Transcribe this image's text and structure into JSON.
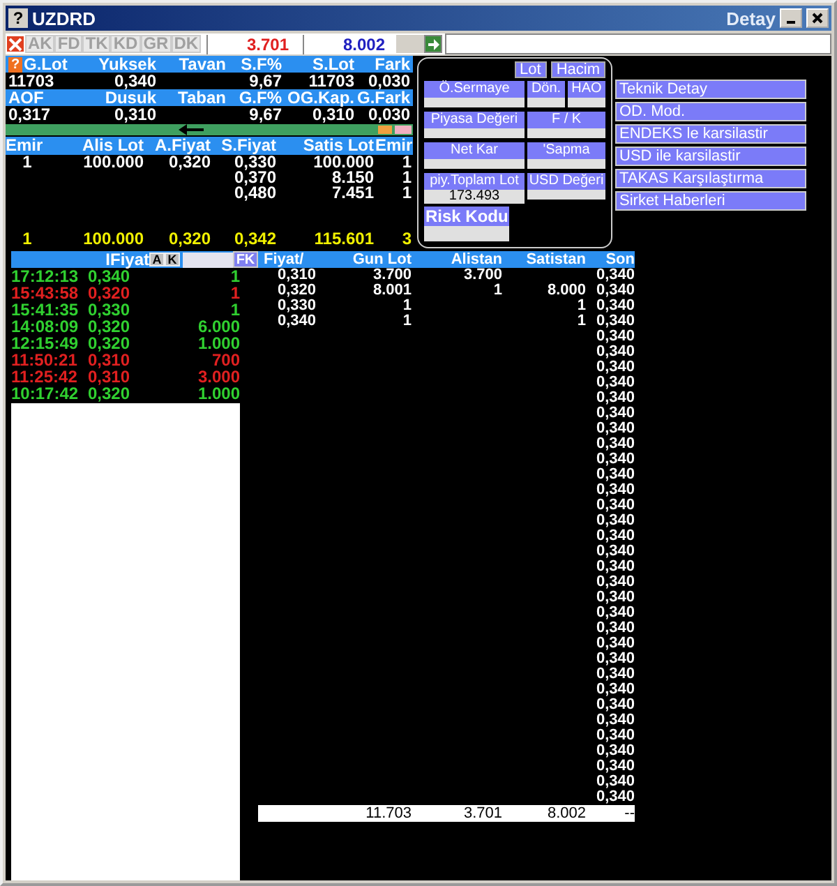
{
  "window": {
    "help": "?",
    "title": "UZDRD",
    "right_title": "Detay"
  },
  "summary_help": "?",
  "toolbar": {
    "tabs": [
      "AK",
      "FD",
      "TK",
      "KD",
      "GR",
      "DK"
    ],
    "buy_total": "3.701",
    "sell_total": "8.002"
  },
  "summary": [
    {
      "kind": "header",
      "cells": [
        "G.Lot",
        "Yuksek",
        "Tavan",
        "S.F%",
        "S.Lot",
        "Fark"
      ]
    },
    {
      "kind": "value",
      "cells": [
        "11703",
        "0,340",
        null,
        "9,67",
        "11703",
        "0,030"
      ]
    },
    {
      "kind": "header",
      "cells": [
        "AOF",
        "Dusuk",
        "Taban",
        "G.F%",
        "OG.Kap.",
        "G.Fark"
      ]
    },
    {
      "kind": "value",
      "cells": [
        "0,317",
        "0,310",
        null,
        "9,67",
        "0,310",
        "0,030"
      ]
    }
  ],
  "order_book": {
    "headers": [
      "Emir",
      "Alis Lot",
      "A.Fiyat",
      "S.Fiyat",
      "Satis Lot",
      "Emir"
    ],
    "rows": [
      [
        "1",
        "100.000",
        "0,320",
        "0,330",
        "100.000",
        "1"
      ],
      [
        null,
        null,
        null,
        "0,370",
        "8.150",
        "1"
      ],
      [
        null,
        null,
        null,
        "0,480",
        "7.451",
        "1"
      ]
    ],
    "totals": [
      "1",
      "100.000",
      "0,320",
      "0,342",
      "115.601",
      "3"
    ]
  },
  "details": {
    "buttons": [
      "Lot",
      "Hacim"
    ],
    "fields": [
      {
        "label": "Ö.Sermaye",
        "kind": "wide"
      },
      {
        "label": "Dön.",
        "kind": "small"
      },
      {
        "label": "HAO",
        "kind": "small"
      },
      {
        "label": "Piyasa Değeri",
        "kind": "wide"
      },
      {
        "label": "F / K",
        "kind": "half"
      },
      {
        "label": "Net Kar",
        "kind": "wide"
      },
      {
        "label": "'Sapma",
        "kind": "half"
      },
      {
        "label": "piy.Toplam Lot",
        "kind": "wide",
        "value": "173.493"
      },
      {
        "label": "USD Değeri",
        "kind": "half"
      }
    ],
    "risk_label": "Risk Kodu"
  },
  "menu": [
    "Teknik Detay",
    "OD. Mod.",
    "ENDEKS le karsilastir",
    "USD ile karsilastir",
    "TAKAS Karşılaştırma",
    "Sirket Haberleri"
  ],
  "trades": {
    "header": "IFiyat",
    "buttons": [
      "A",
      "K"
    ],
    "filter_button": "FK",
    "rows": [
      {
        "time": "17:12:13",
        "price": "0,340",
        "lot": "1",
        "kind": "up"
      },
      {
        "time": "15:43:58",
        "price": "0,320",
        "lot": "1",
        "kind": "down"
      },
      {
        "time": "15:41:35",
        "price": "0,330",
        "lot": "1",
        "kind": "up"
      },
      {
        "time": "14:08:09",
        "price": "0,320",
        "lot": "6.000",
        "kind": "up"
      },
      {
        "time": "12:15:49",
        "price": "0,320",
        "lot": "1.000",
        "kind": "up"
      },
      {
        "time": "11:50:21",
        "price": "0,310",
        "lot": "700",
        "kind": "down"
      },
      {
        "time": "11:25:42",
        "price": "0,310",
        "lot": "3.000",
        "kind": "down"
      },
      {
        "time": "10:17:42",
        "price": "0,320",
        "lot": "1.000",
        "kind": "up"
      }
    ]
  },
  "price_table": {
    "columns": [
      "Fiyat/",
      "Gun Lot",
      "Alistan",
      "Satistan",
      "Son"
    ],
    "rows": [
      [
        "0,310",
        "3.700",
        "3.700",
        null
      ],
      [
        "0,320",
        "8.001",
        "1",
        "8.000"
      ],
      [
        "0,330",
        "1",
        null,
        "1"
      ],
      [
        "0,340",
        "1",
        null,
        "1"
      ]
    ],
    "son": [
      "0,340",
      "0,340",
      "0,340",
      "0,340",
      "0,340",
      "0,340",
      "0,340",
      "0,340",
      "0,340",
      "0,340",
      "0,340",
      "0,340",
      "0,340",
      "0,340",
      "0,340",
      "0,340",
      "0,340",
      "0,340",
      "0,340",
      "0,340",
      "0,340",
      "0,340",
      "0,340",
      "0,340",
      "0,340",
      "0,340",
      "0,340",
      "0,340",
      "0,340",
      "0,340",
      "0,340",
      "0,340",
      "0,340",
      "0,340",
      "0,340"
    ],
    "totals": [
      "11.703",
      "3.701",
      "8.002",
      "--"
    ]
  }
}
